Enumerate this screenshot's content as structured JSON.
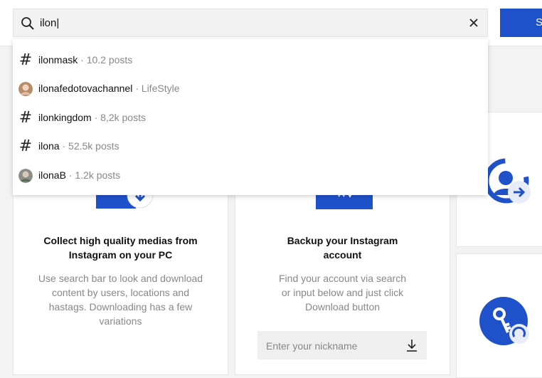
{
  "search": {
    "value": "ilon|",
    "clear_icon": "close-icon",
    "search_icon": "search-icon"
  },
  "top_button": {
    "label": "S"
  },
  "suggestions": [
    {
      "kind": "hashtag",
      "icon": "hashtag-icon",
      "name": "ilonmask",
      "meta": " · 10.2 posts"
    },
    {
      "kind": "account",
      "icon": "avatar",
      "name": "ilonafedotovachannel",
      "meta": " · LifeStyle"
    },
    {
      "kind": "hashtag",
      "icon": "hashtag-icon",
      "name": "ilonkingdom",
      "meta": " · 8,2k posts"
    },
    {
      "kind": "hashtag",
      "icon": "hashtag-icon",
      "name": "ilona",
      "meta": " · 52.5k posts"
    },
    {
      "kind": "account",
      "icon": "avatar",
      "name": "ilonaB",
      "meta": " · 1.2k posts"
    }
  ],
  "cards": [
    {
      "title_line1": "Collect high quality medias from",
      "title_line2": "Instagram on your PC",
      "desc_lines": [
        "Use search bar to look and download",
        "content by users, locations and",
        "hastags. Downloading has a few",
        "variations"
      ]
    },
    {
      "title_line1": "Backup your Instagram",
      "title_line2": "account",
      "desc_lines": [
        "Find your account via search",
        "or input below and just click",
        "Download button"
      ],
      "input_placeholder": "Enter your nickname"
    }
  ],
  "colors": {
    "accent": "#1f51cb",
    "background": "#f3f3f3"
  }
}
